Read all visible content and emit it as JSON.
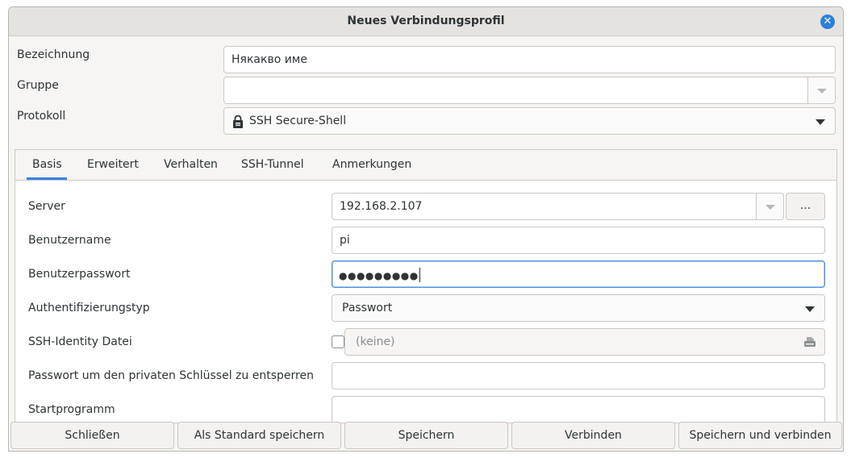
{
  "window": {
    "title": "Neues Verbindungsprofil",
    "close_glyph": "✕"
  },
  "top_form": {
    "name_label": "Bezeichnung",
    "name_value": "Някакво име",
    "group_label": "Gruppe",
    "group_value": "",
    "protocol_label": "Protokoll",
    "protocol_value": "SSH Secure-Shell",
    "protocol_icon": "lock-icon"
  },
  "tabs": [
    {
      "label": "Basis",
      "active": true
    },
    {
      "label": "Erweitert",
      "active": false
    },
    {
      "label": "Verhalten",
      "active": false
    },
    {
      "label": "SSH-Tunnel",
      "active": false
    },
    {
      "label": "Anmerkungen",
      "active": false
    }
  ],
  "basis": {
    "server_label": "Server",
    "server_value": "192.168.2.107",
    "server_browse_label": "...",
    "username_label": "Benutzername",
    "username_value": "pi",
    "password_label": "Benutzerpasswort",
    "password_mask": "●●●●●●●●●",
    "auth_label": "Authentifizierungstyp",
    "auth_value": "Passwort",
    "identity_label": "SSH-Identity Datei",
    "identity_checked": false,
    "identity_placeholder": "(keine)",
    "identity_icon": "file-icon",
    "key_password_label": "Passwort um den privaten Schlüssel zu entsperren",
    "key_password_value": "",
    "startprogram_label": "Startprogramm",
    "startprogram_value": ""
  },
  "buttons": {
    "close": "Schließen",
    "save_default": "Als Standard speichern",
    "save": "Speichern",
    "connect": "Verbinden",
    "save_connect": "Speichern und verbinden"
  },
  "colors": {
    "accent": "#3584e4",
    "close_button": "#2d7fd8",
    "focus_border": "#4a90d9"
  }
}
